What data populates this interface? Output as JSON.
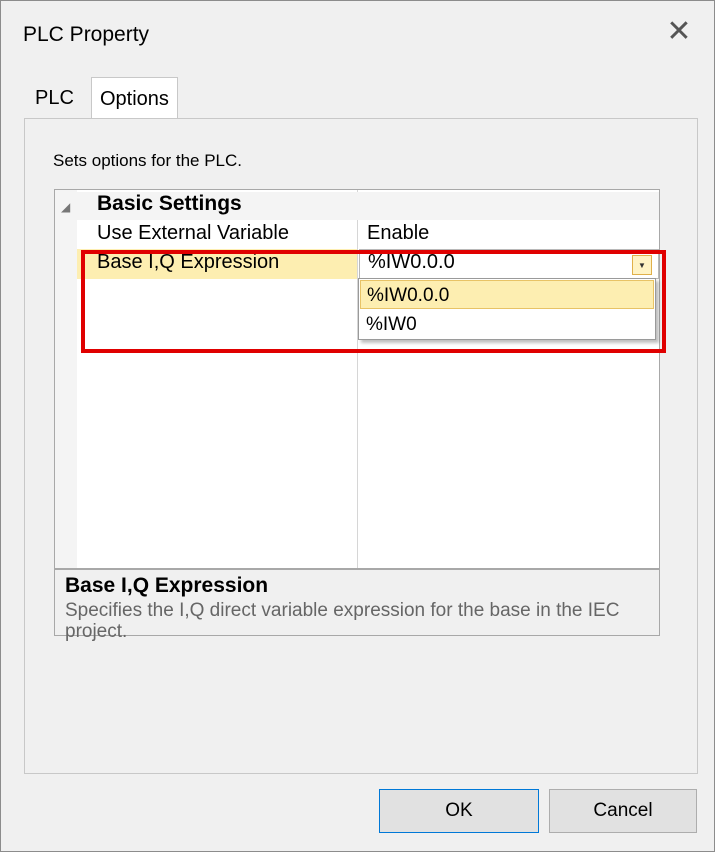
{
  "window": {
    "title": "PLC Property"
  },
  "tabs": [
    {
      "label": "PLC",
      "selected": false
    },
    {
      "label": "Options",
      "selected": true
    }
  ],
  "panel": {
    "description": "Sets options for the PLC."
  },
  "property_grid": {
    "category": "Basic Settings",
    "rows": [
      {
        "name": "Use External Variable",
        "value": "Enable"
      },
      {
        "name": "Base I,Q Expression",
        "value": "%IW0.0.0"
      }
    ],
    "dropdown_options": [
      "%IW0.0.0",
      "%IW0"
    ],
    "help": {
      "title": "Base I,Q Expression",
      "text": "Specifies the I,Q direct variable expression for the base in the IEC project."
    }
  },
  "buttons": {
    "ok": "OK",
    "cancel": "Cancel"
  },
  "colors": {
    "highlight_border": "#e00000",
    "selection": "#fdeeb1",
    "ok_border": "#0078d7"
  }
}
